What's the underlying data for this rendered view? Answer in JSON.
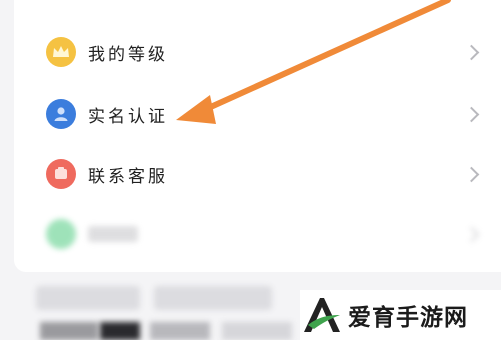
{
  "menu": {
    "items": [
      {
        "label": "我的等级",
        "icon": "crown-icon",
        "color": "#f5c242"
      },
      {
        "label": "实名认证",
        "icon": "user-id-icon",
        "color": "#3b7ddd"
      },
      {
        "label": "联系客服",
        "icon": "service-icon",
        "color": "#ef6a5e"
      },
      {
        "label": "",
        "icon": "settings-icon",
        "color": "#5fd08c"
      }
    ]
  },
  "watermark": {
    "text": "爱育手游网",
    "accent": "#3fa34d"
  },
  "annotation": {
    "arrow_color": "#f08a38"
  }
}
